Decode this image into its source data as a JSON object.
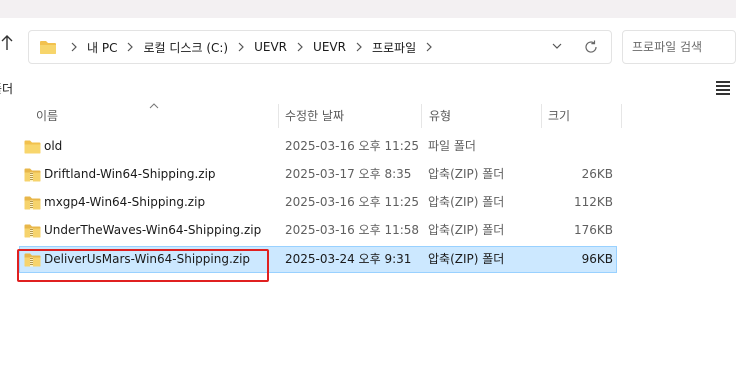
{
  "address_bar": {
    "breadcrumbs": [
      "내 PC",
      "로컬 디스크 (C:)",
      "UEVR",
      "UEVR",
      "프로파일"
    ]
  },
  "search": {
    "placeholder": "프로파일 검색"
  },
  "toolbar": {
    "partial_label": "폴더"
  },
  "columns": {
    "name": "이름",
    "date": "수정한 날짜",
    "type": "유형",
    "size": "크기"
  },
  "files": [
    {
      "name": "old",
      "date": "2025-03-16 오후 11:25",
      "type": "파일 폴더",
      "size": "",
      "kind": "folder",
      "selected": false
    },
    {
      "name": "Driftland-Win64-Shipping.zip",
      "date": "2025-03-17 오후 8:35",
      "type": "압축(ZIP) 폴더",
      "size": "26KB",
      "kind": "zip",
      "selected": false
    },
    {
      "name": "mxgp4-Win64-Shipping.zip",
      "date": "2025-03-16 오후 11:25",
      "type": "압축(ZIP) 폴더",
      "size": "112KB",
      "kind": "zip",
      "selected": false
    },
    {
      "name": "UnderTheWaves-Win64-Shipping.zip",
      "date": "2025-03-16 오후 11:58",
      "type": "압축(ZIP) 폴더",
      "size": "176KB",
      "kind": "zip",
      "selected": false
    },
    {
      "name": "DeliverUsMars-Win64-Shipping.zip",
      "date": "2025-03-24 오후 9:31",
      "type": "압축(ZIP) 폴더",
      "size": "96KB",
      "kind": "zip",
      "selected": true
    }
  ],
  "colors": {
    "selection_bg": "#cce8ff",
    "selection_border": "#99d1ff",
    "folder": "#f2c14e",
    "annotation": "#e02020"
  }
}
